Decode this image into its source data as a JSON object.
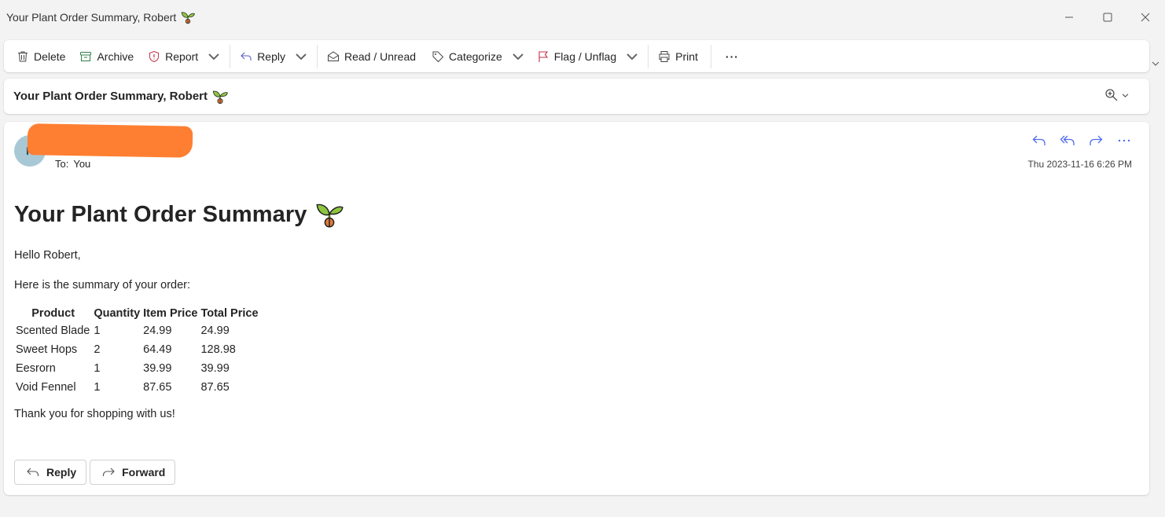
{
  "window": {
    "title": "Your Plant Order Summary, Robert"
  },
  "toolbar": {
    "delete": "Delete",
    "archive": "Archive",
    "report": "Report",
    "reply": "Reply",
    "read_unread": "Read / Unread",
    "categorize": "Categorize",
    "flag": "Flag / Unflag",
    "print": "Print",
    "more": "···"
  },
  "subject": "Your Plant Order Summary, Robert",
  "message": {
    "avatar_initial": "R",
    "to_label": "To:",
    "to_value": "You",
    "datetime": "Thu 2023-11-16 6:26 PM",
    "heading": "Your Plant Order Summary",
    "greeting": "Hello Robert,",
    "intro": "Here is the summary of your order:",
    "table": {
      "headers": [
        "Product",
        "Quantity",
        "Item Price",
        "Total Price"
      ],
      "rows": [
        [
          "Scented Blade",
          "1",
          "24.99",
          "24.99"
        ],
        [
          "Sweet Hops",
          "2",
          "64.49",
          "128.98"
        ],
        [
          "Eesrorn",
          "1",
          "39.99",
          "39.99"
        ],
        [
          "Void Fennel",
          "1",
          "87.65",
          "87.65"
        ]
      ]
    },
    "closing": "Thank you for shopping with us!"
  },
  "footer_buttons": {
    "reply": "Reply",
    "forward": "Forward"
  },
  "colors": {
    "accent": "#4f6bed",
    "redaction": "#ff7f32",
    "avatar_bg": "#a9c8d6"
  }
}
